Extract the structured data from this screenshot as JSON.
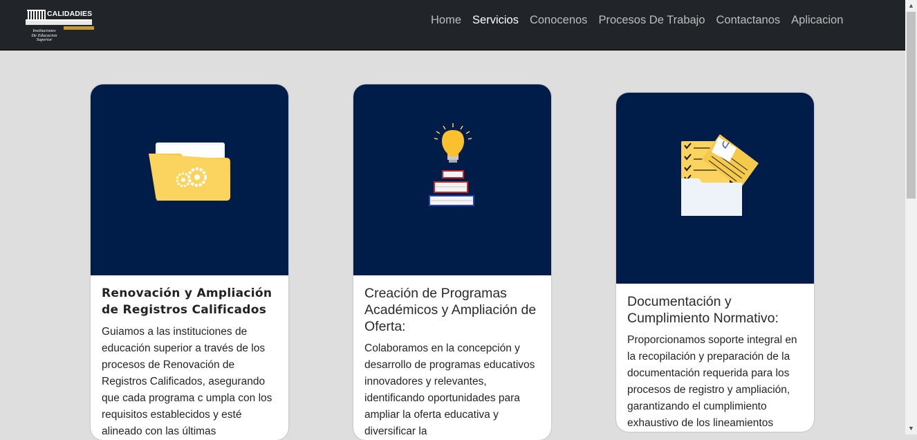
{
  "brand": {
    "name": "CALIDADIES",
    "tagline_line1": "Instituciones",
    "tagline_line2": "De Educacion",
    "tagline_line3": "Superior"
  },
  "nav": {
    "items": [
      {
        "label": "Home"
      },
      {
        "label": "Servicios",
        "active": true
      },
      {
        "label": "Conocenos"
      },
      {
        "label": "Procesos De Trabajo"
      },
      {
        "label": "Contactanos"
      },
      {
        "label": "Aplicacion"
      }
    ]
  },
  "cards": [
    {
      "icon": "folder-gears-icon",
      "title": "Renovación y Ampliación de Registros Calificados",
      "text": "Guiamos a las instituciones de educación superior a través de los procesos de Renovación de Registros Calificados, asegurando que cada programa c umpla con los requisitos establecidos y esté alineado con las últimas"
    },
    {
      "icon": "lightbulb-books-icon",
      "title": "Creación de Programas Académicos y Ampliación de Oferta:",
      "text": "Colaboramos en la concepción y desarrollo de programas educativos innovadores y relevantes, identificando oportunidades para ampliar la oferta educativa y diversificar la"
    },
    {
      "icon": "documents-folder-icon",
      "title": "Documentación y Cumplimiento Normativo:",
      "text": "Proporcionamos soporte integral en la recopilación y preparación de la documentación requerida para los procesos de registro y ampliación, garantizando el cumplimiento exhaustivo de los lineamientos"
    }
  ],
  "colors": {
    "navbar": "#212529",
    "page_bg": "#dedede",
    "card_image_bg": "#001c48",
    "accent_yellow": "#fbd45f"
  }
}
